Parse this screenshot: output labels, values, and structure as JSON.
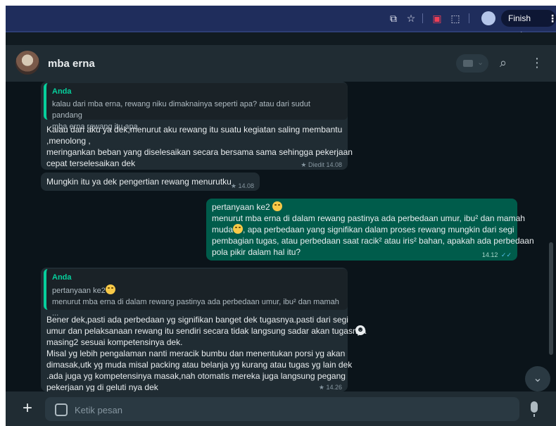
{
  "browser": {
    "finish_update_label": "Finish update"
  },
  "chat": {
    "contact_name": "mba erna",
    "composer_placeholder": "Ketik pesan"
  },
  "messages": {
    "m1": {
      "quote_author": "Anda",
      "quote_line1": "kalau dari mba erna, rewang niku dimaknainya seperti apa? atau dari sudut pandang",
      "quote_line2": "mba erna rewang itu apa",
      "line1": "Kalau dari aku ya dek,menurut aku rewang itu suatu kegiatan saling membantu",
      "line2": ",menolong ,",
      "line3": "meringankan beban yang diselesaikan secara bersama sama sehingga pekerjaan",
      "line4": "cepat terselesaikan dek",
      "meta": "Diedit 14.08"
    },
    "m2": {
      "text": "Mungkin itu ya dek pengertian rewang menurutku",
      "meta": "14.08"
    },
    "m3": {
      "line1": "pertanyaan ke2",
      "line2": "menurut mba erna di dalam rewang pastinya ada perbedaan umur, ibu² dan mamah",
      "line3a": "muda",
      "line3b": ", apa perbedaan yang signifikan dalam proses rewang mungkin dari segi",
      "line4": "pembagian tugas, atau perbedaan saat racik² atau iris² bahan, apakah ada perbedaan",
      "line5": "pola pikir dalam hal itu?",
      "time": "14.12",
      "ticks": "✓✓"
    },
    "m4": {
      "quote_author": "Anda",
      "quote_line1": "pertanyaan ke2",
      "quote_line2": "menurut mba erna di dalam rewang pastinya ada perbedaan umur, ibu² dan mamah ...",
      "line1": "Bener dek,pasti ada perbedaan yg signifikan banget dek tugasnya.pasti dari segi",
      "line2": "umur dan pelaksanaan rewang itu sendiri secara tidak langsung sadar akan tugasnya",
      "line3": "masing2 sesuai kompetensinya dek.",
      "line4": "Misal yg lebih pengalaman nanti meracik bumbu dan menentukan porsi yg akan",
      "line5": "dimasak,utk yg muda misal packing atau belanja yg kurang atau tugas yg lain dek",
      "line6": ".ada juga yg kompetensinya masak,nah otomatis mereka juga langsung pegang",
      "line7": "pekerjaan yg di geluti nya dek",
      "meta": "14.26"
    }
  },
  "colors": {
    "incoming_bubble": "#202c33",
    "outgoing_bubble": "#005c4b",
    "accent_green": "#06cf9c",
    "read_ticks": "#53bdeb",
    "browser_toolbar": "#1f2d5c"
  },
  "icons": {
    "toolbar": [
      "open-in-app-icon",
      "star-icon",
      "pocket-icon",
      "extensions-icon",
      "profile-icon",
      "kebab-menu-icon"
    ],
    "header": [
      "video-call-icon",
      "search-icon",
      "menu-icon"
    ],
    "composer": [
      "plus-icon",
      "sticker-icon",
      "mic-icon"
    ]
  }
}
